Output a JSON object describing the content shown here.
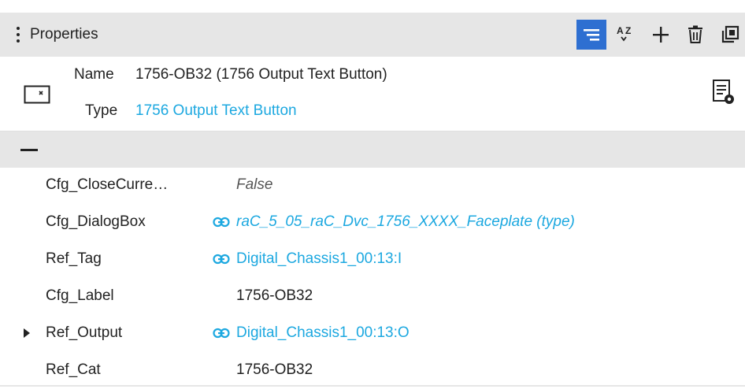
{
  "header": {
    "title": "Properties",
    "toolbar": [
      {
        "name": "category-view-icon",
        "active": true
      },
      {
        "name": "sort-az-icon",
        "active": false
      },
      {
        "name": "add-icon",
        "active": false
      },
      {
        "name": "delete-icon",
        "active": false
      },
      {
        "name": "popout-icon",
        "active": false
      }
    ]
  },
  "info": {
    "name_label": "Name",
    "name_value": "1756-OB32 (1756 Output Text Button)",
    "type_label": "Type",
    "type_value": "1756 Output Text Button"
  },
  "properties": [
    {
      "name": "Cfg_CloseCurre…",
      "value": "False",
      "style": "italic",
      "link": false,
      "expandable": false
    },
    {
      "name": "Cfg_DialogBox",
      "value": "raC_5_05_raC_Dvc_1756_XXXX_Faceplate (type)",
      "style": "italic",
      "link": true,
      "expandable": false
    },
    {
      "name": "Ref_Tag",
      "value": "Digital_Chassis1_00:13:I",
      "style": "normal",
      "link": true,
      "expandable": false
    },
    {
      "name": "Cfg_Label",
      "value": "1756-OB32",
      "style": "normal",
      "link": false,
      "expandable": false
    },
    {
      "name": "Ref_Output",
      "value": "Digital_Chassis1_00:13:O",
      "style": "normal",
      "link": true,
      "expandable": true
    },
    {
      "name": "Ref_Cat",
      "value": "1756-OB32",
      "style": "normal",
      "link": false,
      "expandable": false
    }
  ],
  "colors": {
    "accent": "#2e6fd1",
    "link": "#1ca8e0",
    "header_bg": "#e6e6e6"
  }
}
